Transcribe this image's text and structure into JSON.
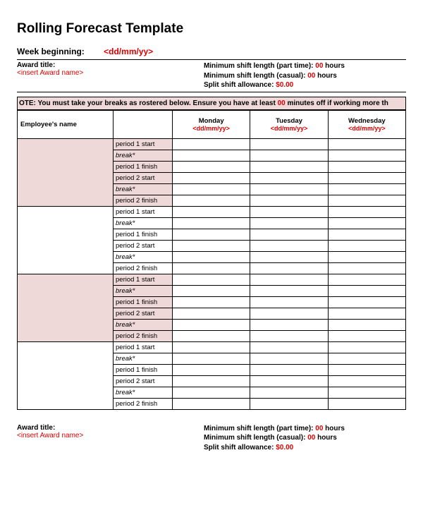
{
  "title": "Rolling Forecast Template",
  "week": {
    "label": "Week beginning:",
    "value": "<dd/mm/yy>"
  },
  "award_top": {
    "title_label": "Award title:",
    "title_value": "<insert Award name>",
    "min_part_label": "Minimum shift length (part time): ",
    "min_part_value": "00",
    "min_part_suffix": " hours",
    "min_cas_label": "Minimum shift length (casual): ",
    "min_cas_value": "00",
    "min_cas_suffix": " hours",
    "split_label": "Split shift allowance: ",
    "split_value": "$0.00"
  },
  "note": {
    "prefix": "OTE: You must take your breaks as rostered below. Ensure you have at least ",
    "minutes": "00",
    "suffix": " minutes off if working more th"
  },
  "header": {
    "employee": "Employee's name",
    "days": [
      {
        "name": "Monday",
        "date": "<dd/mm/yy>"
      },
      {
        "name": "Tuesday",
        "date": "<dd/mm/yy>"
      },
      {
        "name": "Wednesday",
        "date": "<dd/mm/yy>"
      }
    ]
  },
  "periods": [
    "period 1 start",
    "break*",
    "period 1 finish",
    "period 2 start",
    "break*",
    "period 2 finish"
  ],
  "award_bottom": {
    "title_label": "Award title:",
    "title_value": "<insert Award name>",
    "min_part_label": "Minimum shift length (part time): ",
    "min_part_value": "00",
    "min_part_suffix": " hours",
    "min_cas_label": "Minimum shift length (casual): ",
    "min_cas_value": "00",
    "min_cas_suffix": " hours",
    "split_label": "Split shift allowance: ",
    "split_value": "$0.00"
  }
}
